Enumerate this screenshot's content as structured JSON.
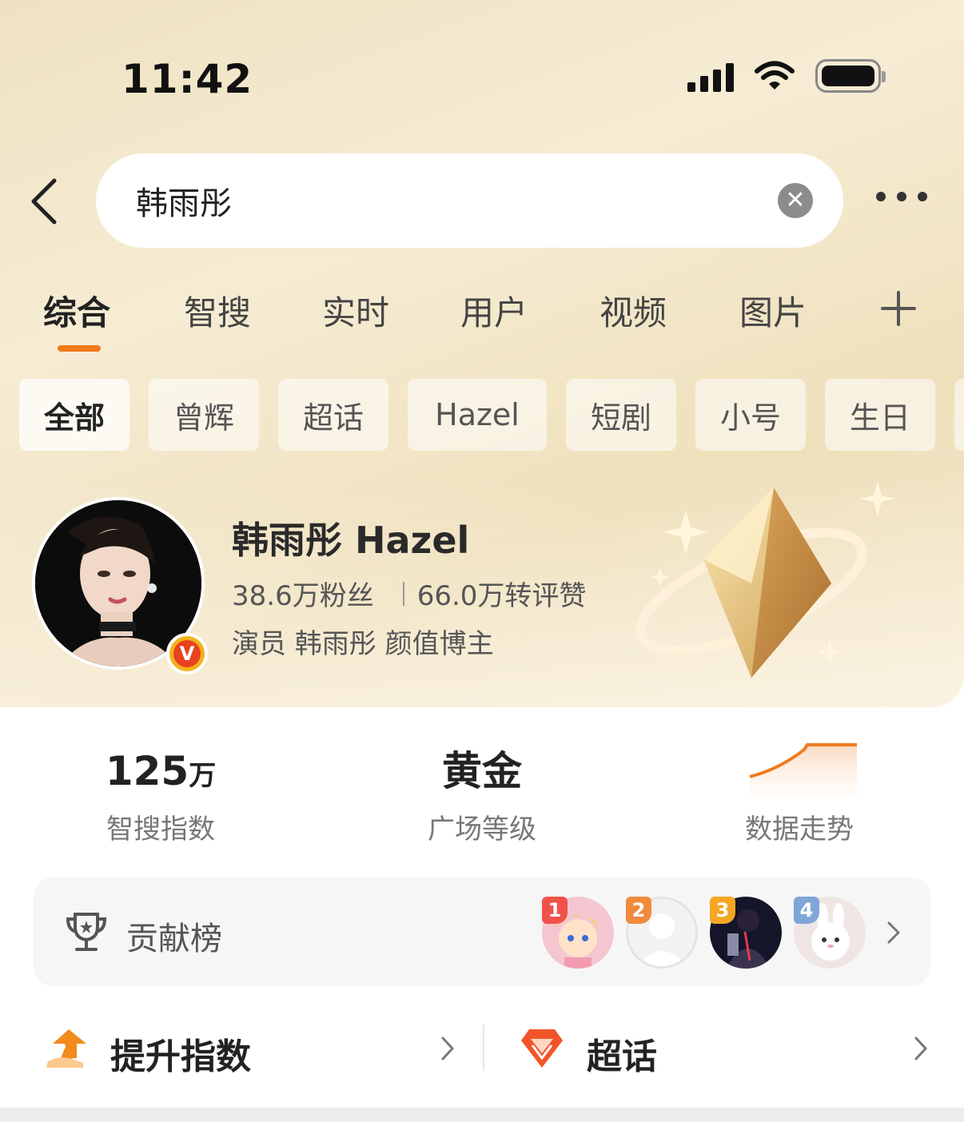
{
  "status_bar": {
    "time": "11:42"
  },
  "search": {
    "query": "韩雨彤"
  },
  "tabs": [
    {
      "label": "综合",
      "active": true
    },
    {
      "label": "智搜"
    },
    {
      "label": "实时"
    },
    {
      "label": "用户"
    },
    {
      "label": "视频"
    },
    {
      "label": "图片"
    }
  ],
  "chips": [
    {
      "label": "全部",
      "active": true
    },
    {
      "label": "曾辉"
    },
    {
      "label": "超话"
    },
    {
      "label": "Hazel"
    },
    {
      "label": "短剧"
    },
    {
      "label": "小号"
    },
    {
      "label": "生日"
    }
  ],
  "profile": {
    "name": "韩雨彤 Hazel",
    "fans": "38.6万粉丝",
    "interactions": "66.0万转评赞",
    "description": "演员 韩雨彤 颜值博主",
    "verified_badge": "V"
  },
  "metrics": {
    "index_value": "125",
    "index_unit": "万",
    "index_label": "智搜指数",
    "level_value": "黄金",
    "level_label": "广场等级",
    "trend_label": "数据走势"
  },
  "contribution": {
    "label": "贡献榜",
    "ranks": [
      "1",
      "2",
      "3",
      "4"
    ]
  },
  "links": {
    "boost": "提升指数",
    "supertopic": "超话"
  },
  "colors": {
    "accent": "#f07a1c",
    "verified": "#e8421f"
  }
}
